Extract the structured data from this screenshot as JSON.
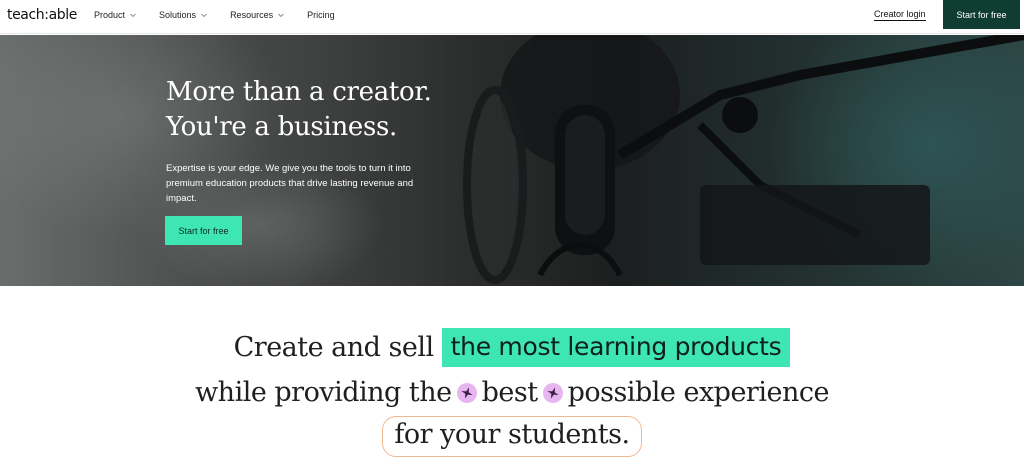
{
  "nav": {
    "logo": "teach:able",
    "menu": [
      {
        "label": "Product",
        "has_dropdown": true,
        "icon": "chevron-down-icon"
      },
      {
        "label": "Solutions",
        "has_dropdown": true,
        "icon": "chevron-down-icon"
      },
      {
        "label": "Resources",
        "has_dropdown": true,
        "icon": "chevron-down-icon"
      },
      {
        "label": "Pricing",
        "has_dropdown": false
      }
    ],
    "login_label": "Creator login",
    "cta_label": "Start for free"
  },
  "hero": {
    "title_line1": "More than a creator.",
    "title_line2": "You're a business.",
    "description": "Expertise is your edge. We give you the tools to turn it into premium education products that drive lasting revenue and impact.",
    "cta_label": "Start for free"
  },
  "tagline": {
    "line1_text": "Create and sell",
    "line1_highlight": "the most learning products",
    "line2_part1": "while providing the",
    "line2_part2": "best",
    "line2_part3": "possible experience",
    "line3_text": "for your students.",
    "sparkle_icon": "sparkle-icon"
  },
  "colors": {
    "brand_dark_green": "#0f3d31",
    "accent_mint": "#3ee6b4",
    "sparkle_pink": "#e7b6f0",
    "pill_border_peach": "#f2b991"
  }
}
